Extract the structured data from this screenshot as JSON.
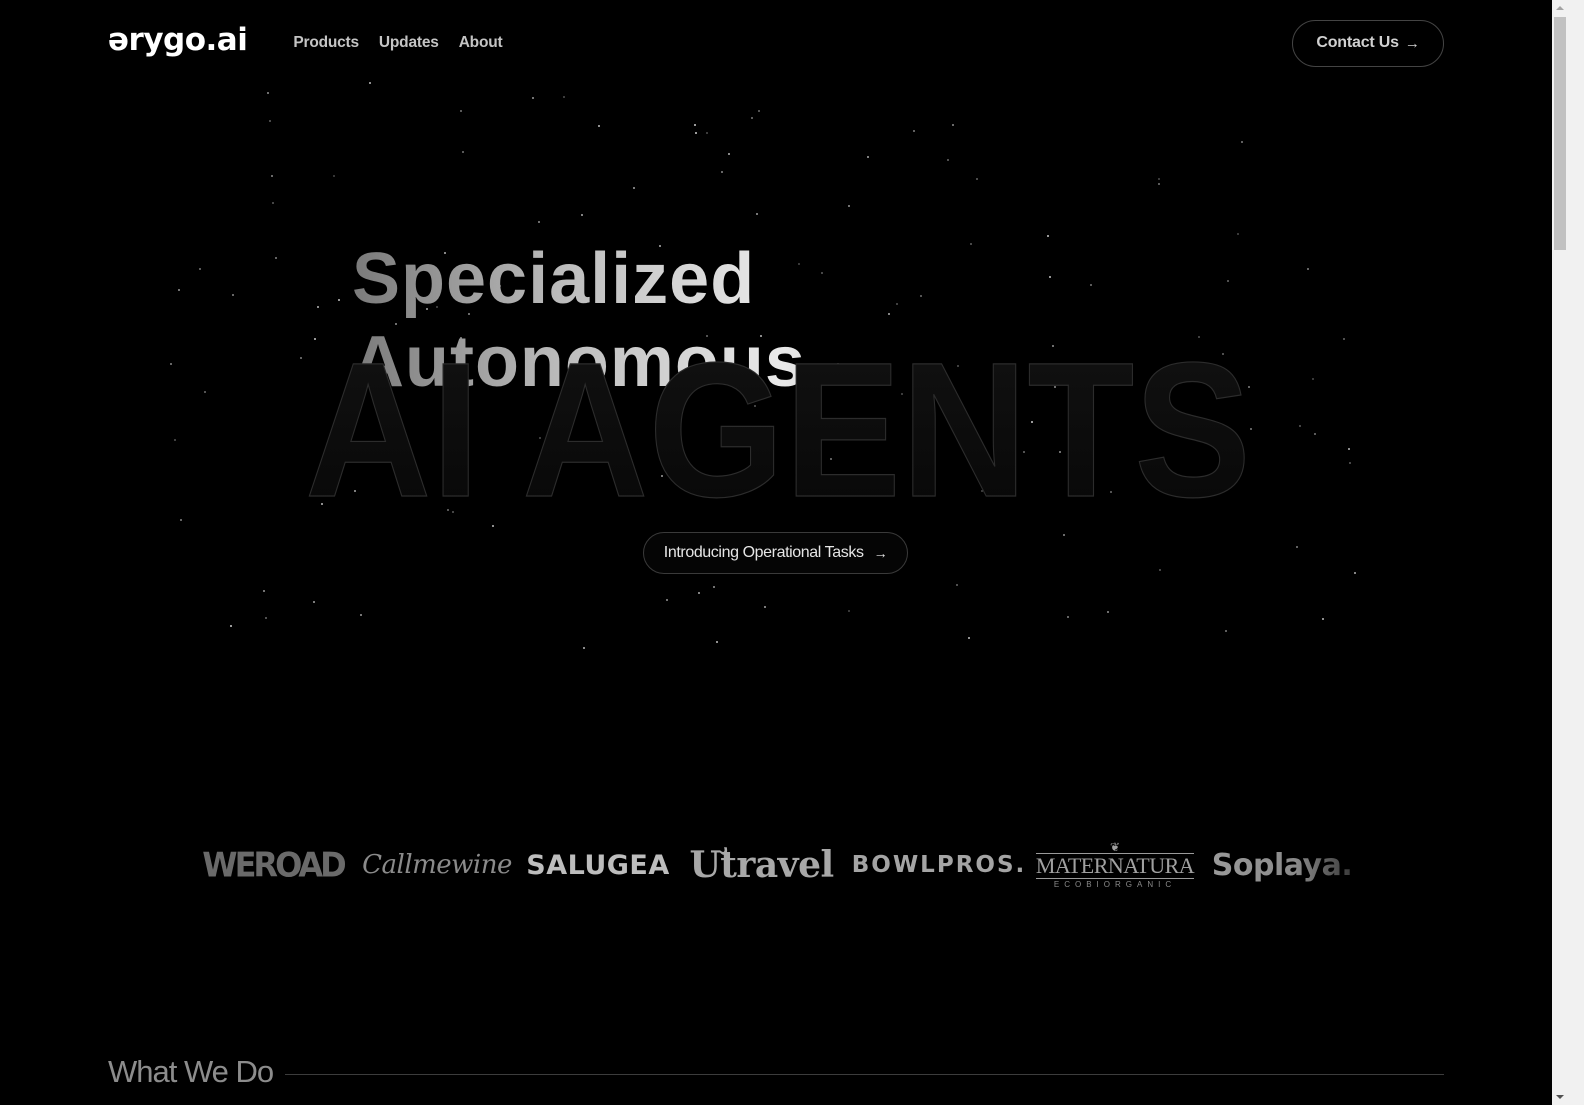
{
  "header": {
    "logo": "ərygo.ai",
    "nav": [
      {
        "label": "Products"
      },
      {
        "label": "Updates"
      },
      {
        "label": "About"
      }
    ],
    "contact_label": "Contact Us",
    "contact_icon": "arrow-right-icon"
  },
  "hero": {
    "subtitle": "Specialized Autonomous",
    "title": "AI AGENTS",
    "pill_label": "Introducing Operational Tasks",
    "pill_icon": "arrow-right-icon"
  },
  "logos": {
    "weroad": "WEROAD",
    "callmewine": "Callmewine",
    "salugea": "SALUGEA",
    "utravel": "Ưtravel",
    "bowlpros": "BOWLPROS.",
    "maternatura_name": "MATERNATURA",
    "maternatura_tag": "ECOBIORGANIC",
    "soplaya": "Soplaya."
  },
  "section": {
    "title": "What We Do"
  },
  "colors": {
    "background": "#000000",
    "text": "#ffffff",
    "muted": "#8c8c8c",
    "border": "#3a3a3a"
  }
}
